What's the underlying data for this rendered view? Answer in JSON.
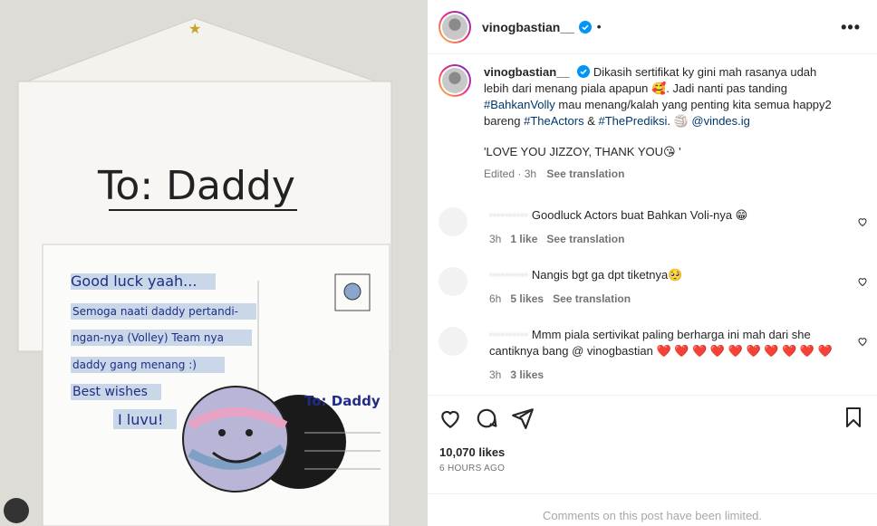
{
  "post": {
    "username": "vinogbastian__",
    "dot": "•",
    "more": "•••",
    "caption_parts": {
      "t1": " Dikasih sertifikat ky gini mah rasanya udah lebih dari menang piala apapun 🥰. Jadi nanti pas tanding ",
      "tag1": "#BahkanVolly",
      "t2": " mau menang/kalah yang penting kita semua happy2 bareng ",
      "tag2": "#TheActors",
      "t3": " & ",
      "tag3": "#ThePrediksi",
      "t4": ". 🏐 ",
      "mention": "@vindes.ig",
      "quote": "'LOVE YOU JIZZOY, THANK YOU😘 '"
    },
    "caption_meta": {
      "edited": "Edited · 3h",
      "see_translation": "See translation"
    },
    "comments": [
      {
        "user": "··········",
        "text": "Goodluck Actors buat Bahkan Voli-nya 😁",
        "time": "3h",
        "likes": "1 like",
        "translate": "See translation"
      },
      {
        "user": "··········",
        "text": "Nangis bgt ga dpt tiketnya🥺",
        "time": "6h",
        "likes": "5 likes",
        "translate": "See translation"
      },
      {
        "user": "··········",
        "text": "Mmm piala sertivikat paling berharga ini mah dari she cantiknya bang @ vinogbastian ❤️ ❤️ ❤️ ❤️ ❤️ ❤️ ❤️ ❤️ ❤️ ❤️",
        "time": "3h",
        "likes": "3 likes",
        "translate": ""
      }
    ],
    "likes": "10,070 likes",
    "time": "6 HOURS AGO",
    "limited": "Comments on this post have been limited."
  },
  "photo": {
    "envelope_text": "To: Daddy",
    "card_lines": [
      "Good luck yaah...",
      "Semoga naati daddy pertandi-",
      "ngan-nya (Volley) Team nya",
      "daddy gang menang :)",
      "Best wishes",
      "I luvu!"
    ],
    "address": "To: Daddy"
  },
  "icons": [
    "verified-icon",
    "more-icon",
    "heart-icon",
    "comment-icon",
    "share-icon",
    "bookmark-icon"
  ],
  "colors": {
    "link": "#00376b",
    "verified": "#0095f6",
    "heart": "#ed4956"
  }
}
